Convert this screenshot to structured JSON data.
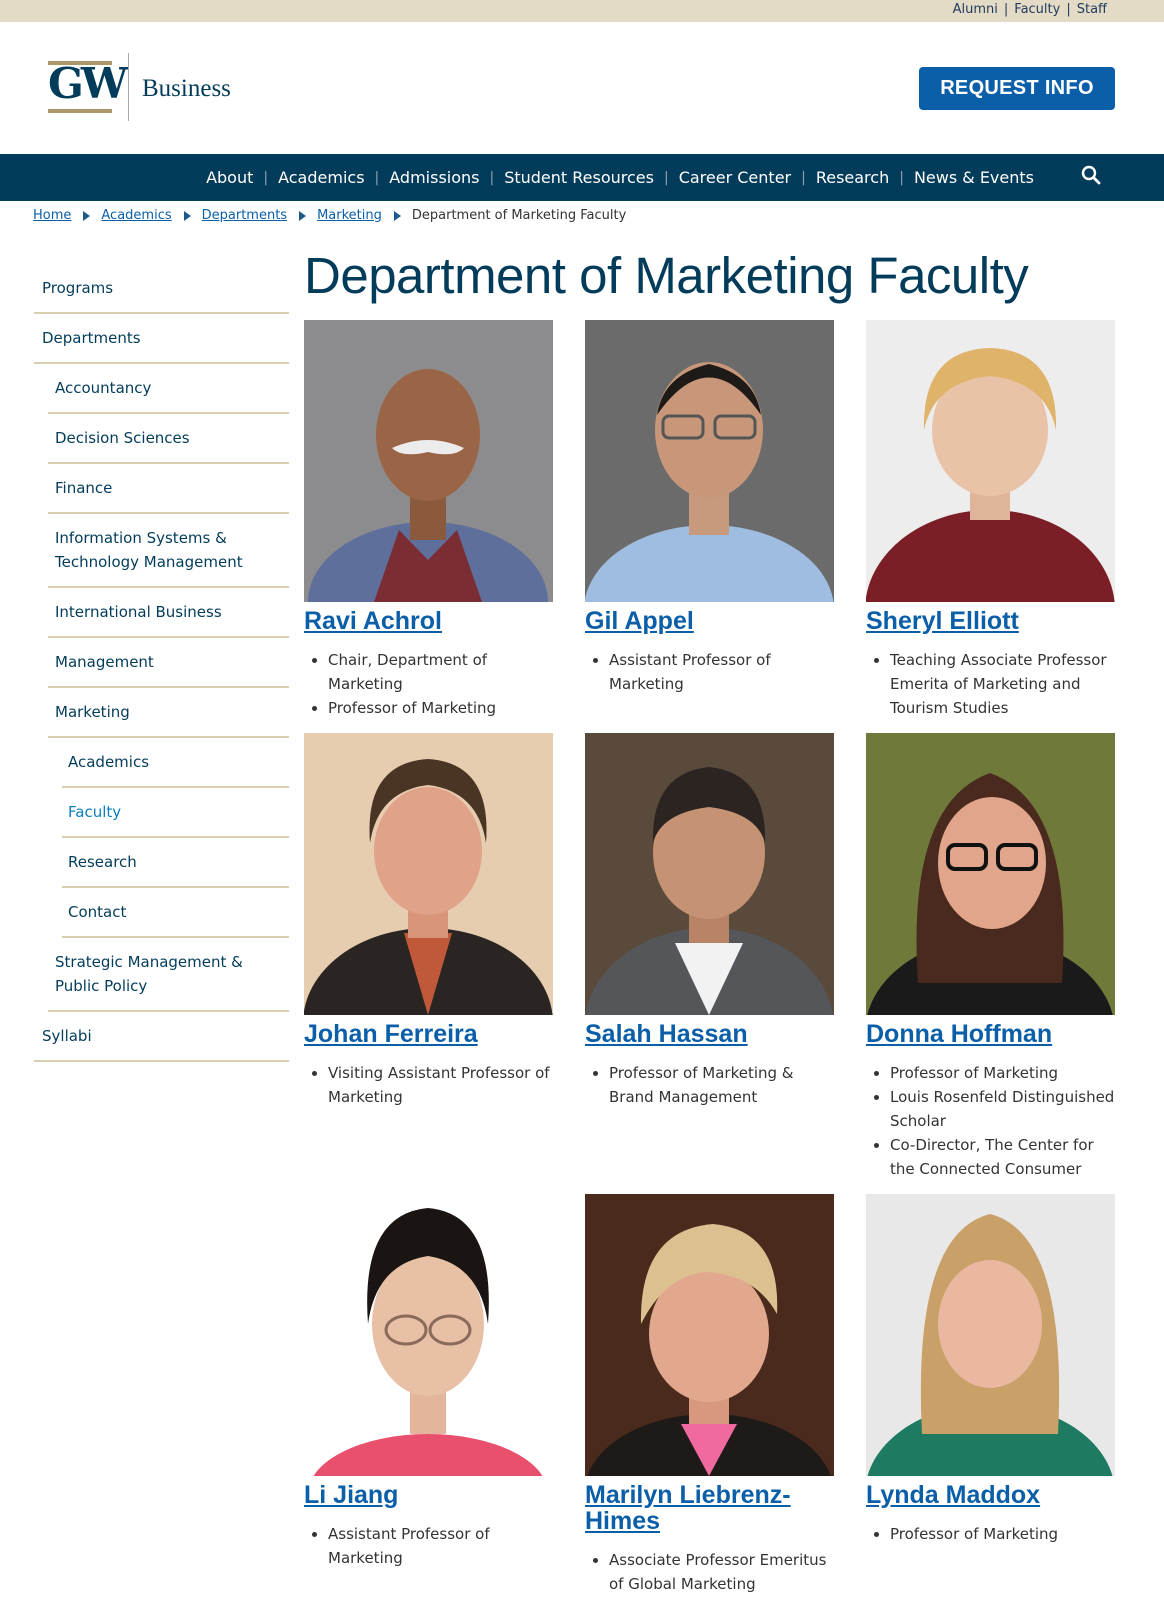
{
  "utility": {
    "links": [
      "Alumni",
      "Faculty",
      "Staff"
    ]
  },
  "logo": {
    "mark": "GW",
    "unit": "Business"
  },
  "header": {
    "request_info": "REQUEST INFO"
  },
  "nav": {
    "items": [
      "About",
      "Academics",
      "Admissions",
      "Student Resources",
      "Career Center",
      "Research",
      "News & Events"
    ]
  },
  "breadcrumb": {
    "links": [
      "Home",
      "Academics",
      "Departments",
      "Marketing"
    ],
    "current": "Department of Marketing Faculty"
  },
  "sidebar": {
    "items": [
      "Programs",
      "Departments",
      "Accountancy",
      "Decision Sciences",
      "Finance",
      "Information Systems & Technology Management",
      "International Business",
      "Management",
      "Marketing",
      "Academics",
      "Faculty",
      "Research",
      "Contact",
      "Strategic Management & Public Policy",
      "Syllabi"
    ]
  },
  "page": {
    "title": "Department of Marketing Faculty"
  },
  "faculty": [
    {
      "name": "Ravi Achrol",
      "titles": [
        "Chair, Department of Marketing",
        "Professor of Marketing"
      ]
    },
    {
      "name": "Gil Appel",
      "titles": [
        "Assistant Professor of Marketing"
      ]
    },
    {
      "name": "Sheryl Elliott",
      "titles": [
        "Teaching Associate Professor Emerita of Marketing and Tourism Studies"
      ]
    },
    {
      "name": "Johan Ferreira",
      "titles": [
        "Visiting Assistant Professor of Marketing"
      ]
    },
    {
      "name": "Salah Hassan",
      "titles": [
        "Professor of Marketing & Brand Management"
      ]
    },
    {
      "name": "Donna Hoffman",
      "titles": [
        "Professor of Marketing",
        "Louis Rosenfeld Distinguished Scholar",
        "Co-Director, The Center for the Connected Consumer"
      ]
    },
    {
      "name": "Li Jiang",
      "titles": [
        "Assistant Professor of Marketing"
      ]
    },
    {
      "name": "Marilyn Liebrenz-Himes",
      "titles": [
        "Associate Professor Emeritus of Global Marketing"
      ]
    },
    {
      "name": "Lynda Maddox",
      "titles": [
        "Professor of Marketing"
      ]
    }
  ],
  "colors": {
    "navy": "#033c5a",
    "gold": "#aa9868",
    "link": "#0b5ea8",
    "utility_bg": "#e3dbc6"
  }
}
